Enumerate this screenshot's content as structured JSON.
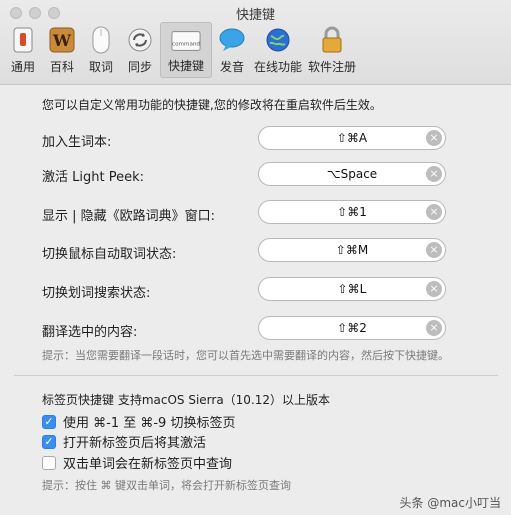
{
  "window": {
    "title": "快捷键"
  },
  "toolbar": {
    "items": [
      {
        "label": "通用",
        "icon": "switch-icon"
      },
      {
        "label": "百科",
        "icon": "wiki-w-icon"
      },
      {
        "label": "取词",
        "icon": "mouse-icon"
      },
      {
        "label": "同步",
        "icon": "sync-icon"
      },
      {
        "label": "快捷键",
        "icon": "keyboard-icon",
        "active": true
      },
      {
        "label": "发音",
        "icon": "speech-bubble-icon"
      },
      {
        "label": "在线功能",
        "icon": "globe-icon"
      },
      {
        "label": "软件注册",
        "icon": "lock-icon"
      }
    ],
    "keyboard_icon_text": "command"
  },
  "main": {
    "intro": "您可以自定义常用功能的快捷键,您的修改将在重启软件后生效。",
    "shortcuts": [
      {
        "label": "加入生词本:",
        "value": "⇧⌘A"
      },
      {
        "label": "激活 Light Peek:",
        "value": "⌥Space"
      },
      {
        "label": "显示 | 隐藏《欧路词典》窗口:",
        "value": "⇧⌘1"
      },
      {
        "label": "切换鼠标自动取词状态:",
        "value": "⇧⌘M"
      },
      {
        "label": "切换划词搜索状态:",
        "value": "⇧⌘L"
      },
      {
        "label": "翻译选中的内容:",
        "value": "⇧⌘2"
      }
    ],
    "clear_symbol": "×",
    "hint": "提示：当您需要翻译一段话时，您可以首先选中需要翻译的内容，然后按下快捷键。"
  },
  "tabs_section": {
    "title": "标签页快捷键 支持macOS Sierra（10.12）以上版本",
    "options": [
      {
        "label": "使用 ⌘-1 至 ⌘-9 切换标签页",
        "checked": true
      },
      {
        "label": "打开新标签页后将其激活",
        "checked": true
      },
      {
        "label": "双击单词会在新标签页中查询",
        "checked": false
      }
    ],
    "check_mark": "✓",
    "hint": "提示：按住 ⌘ 键双击单词，将会打开新标签页查询"
  },
  "watermark": "头条 @mac小叮当",
  "colors": {
    "accent": "#3b8ef0",
    "window_bg": "#ececec",
    "field_bg": "#ffffff"
  }
}
